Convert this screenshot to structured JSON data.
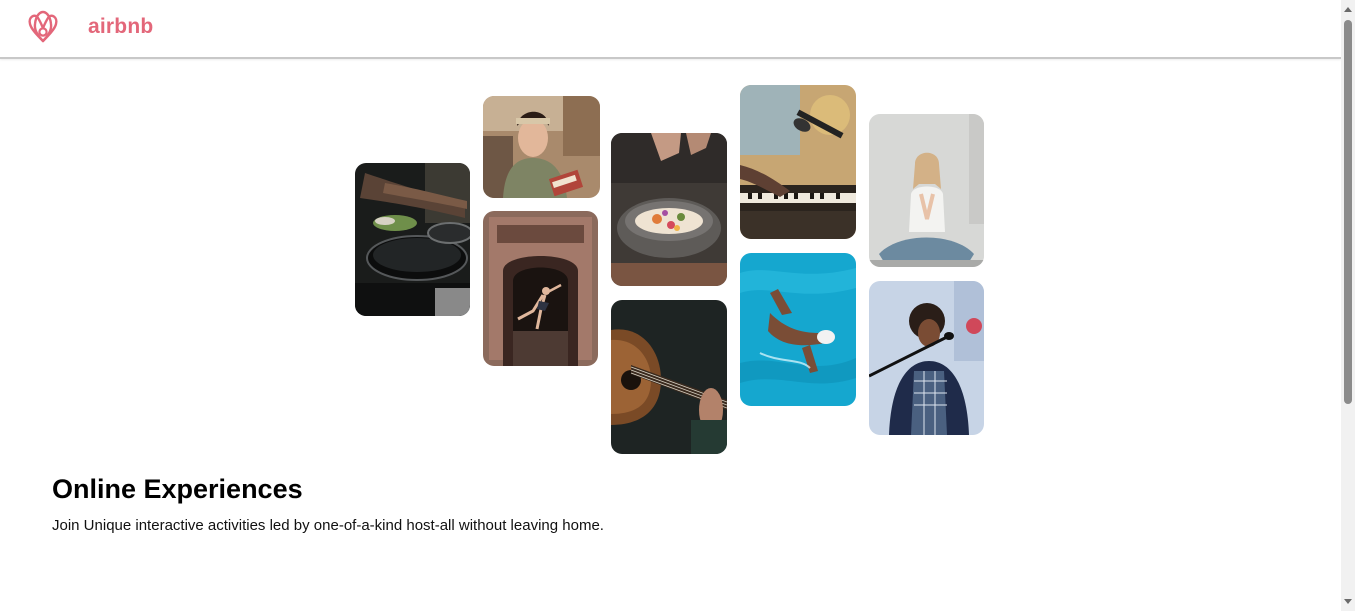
{
  "header": {
    "brand": "airbnb",
    "logo_icon": "airbnb-logo-icon",
    "brand_color": "#e3677a"
  },
  "gallery": [
    {
      "name": "photo-cooking-pans",
      "icon": "cooking-photo"
    },
    {
      "name": "photo-woman-holding-box",
      "icon": "portrait-photo"
    },
    {
      "name": "photo-dancer-doorway",
      "icon": "dance-photo"
    },
    {
      "name": "photo-food-bowl",
      "icon": "food-photo"
    },
    {
      "name": "photo-acoustic-guitar",
      "icon": "guitar-photo"
    },
    {
      "name": "photo-piano-microphone",
      "icon": "music-photo"
    },
    {
      "name": "photo-swimmer-pool",
      "icon": "swimming-photo"
    },
    {
      "name": "photo-yoga-woman",
      "icon": "yoga-photo"
    },
    {
      "name": "photo-singer-microphone",
      "icon": "singer-photo"
    }
  ],
  "hero": {
    "title": "Online Experiences",
    "subtitle": "Join Unique interactive activities led by one-of-a-kind host-all without leaving home."
  }
}
